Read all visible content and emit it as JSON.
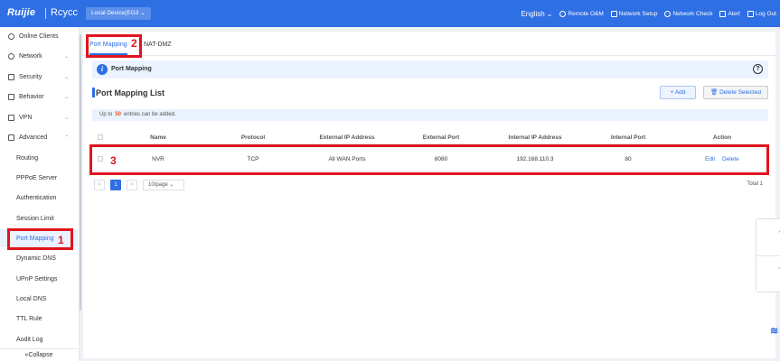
{
  "topbar": {
    "brand": "Ruijie",
    "brand2": "Rcycc",
    "device_select": "Local Device(EG3",
    "language": "English",
    "remote": "Remote O&M",
    "network_setup": "Network Setup",
    "network_check": "Network Check",
    "alert": "Alert",
    "logout": "Log Out"
  },
  "sidebar": {
    "items": [
      {
        "label": "Online Clients"
      },
      {
        "label": "Network"
      },
      {
        "label": "Security"
      },
      {
        "label": "Behavior"
      },
      {
        "label": "VPN"
      },
      {
        "label": "Advanced"
      },
      {
        "label": "Routing"
      },
      {
        "label": "PPPoE Server"
      },
      {
        "label": "Authentication"
      },
      {
        "label": "Session Limit"
      },
      {
        "label": "Port Mapping"
      },
      {
        "label": "Dynamic DNS"
      },
      {
        "label": "UPnP Settings"
      },
      {
        "label": "Local DNS"
      },
      {
        "label": "TTL Rule"
      },
      {
        "label": "Audit Log"
      }
    ],
    "collapse": "Collapse"
  },
  "tabs": [
    "Port Mapping",
    "NAT-DMZ"
  ],
  "info": {
    "title": "Port Mapping",
    "help": "?"
  },
  "list": {
    "title": "Port Mapping List",
    "add_label": "+ Add",
    "delete_selected_label": "Delete Selected",
    "limit_prefix": "Up to",
    "limit_value": "50",
    "limit_suffix": "entries can be added."
  },
  "table": {
    "headers": [
      "Name",
      "Protocol",
      "External IP Address",
      "External Port",
      "Internal IP Address",
      "Internal Port",
      "Action"
    ],
    "rows": [
      {
        "name": "NVR",
        "protocol": "TCP",
        "external_ip": "All WAN Ports",
        "external_port": "8080",
        "internal_ip": "192.168.110.3",
        "internal_port": "80",
        "edit": "Edit",
        "delete": "Delete"
      }
    ]
  },
  "pagination": {
    "prev": "<",
    "current_page": "1",
    "next": ">",
    "page_size": "10/page",
    "total": "Total 1"
  },
  "annotations": [
    "1",
    "2",
    "3"
  ],
  "colors": {
    "accent": "#2f6fe4",
    "annotation": "#e0141e",
    "highlight_number": "#e8591a"
  }
}
